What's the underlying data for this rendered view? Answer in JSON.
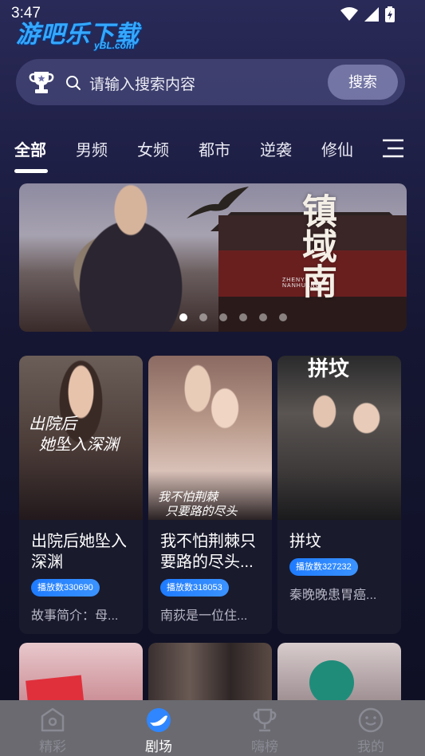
{
  "status_bar": {
    "time": "3:47"
  },
  "watermark": {
    "main": "游吧乐下载",
    "sub": "yBL.com"
  },
  "search": {
    "placeholder": "请输入搜索内容",
    "button_label": "搜索"
  },
  "tabs": [
    {
      "label": "全部",
      "active": true
    },
    {
      "label": "男频"
    },
    {
      "label": "女频"
    },
    {
      "label": "都市"
    },
    {
      "label": "逆袭"
    },
    {
      "label": "修仙"
    }
  ],
  "banner": {
    "title": "镇域南",
    "subtitle": "ZHENYU NANHUANG",
    "dot_count": 6,
    "active_dot": 0
  },
  "cards": [
    {
      "title": "出院后她坠入深渊",
      "play_count": "播放数330690",
      "desc": "故事简介：母...",
      "poster_text": "出院后\n她坠入深渊"
    },
    {
      "title": "我不怕荆棘只要路的尽头...",
      "play_count": "播放数318053",
      "desc": "南荻是一位住...",
      "poster_text": "我不怕荆棘\n只要路的尽头"
    },
    {
      "title": "拼坟",
      "play_count": "播放数327232",
      "desc": "秦晚晚患胃癌...",
      "poster_text": "拼坟"
    }
  ],
  "bottom_nav": [
    {
      "label": "精彩",
      "icon": "circle-icon"
    },
    {
      "label": "剧场",
      "icon": "bird-icon",
      "active": true
    },
    {
      "label": "嗨榜",
      "icon": "trophy-icon"
    },
    {
      "label": "我的",
      "icon": "smile-icon"
    }
  ],
  "colors": {
    "accent": "#2f86ff",
    "bg_top": "#2a2a58",
    "nav_bg": "#6a6a70"
  }
}
